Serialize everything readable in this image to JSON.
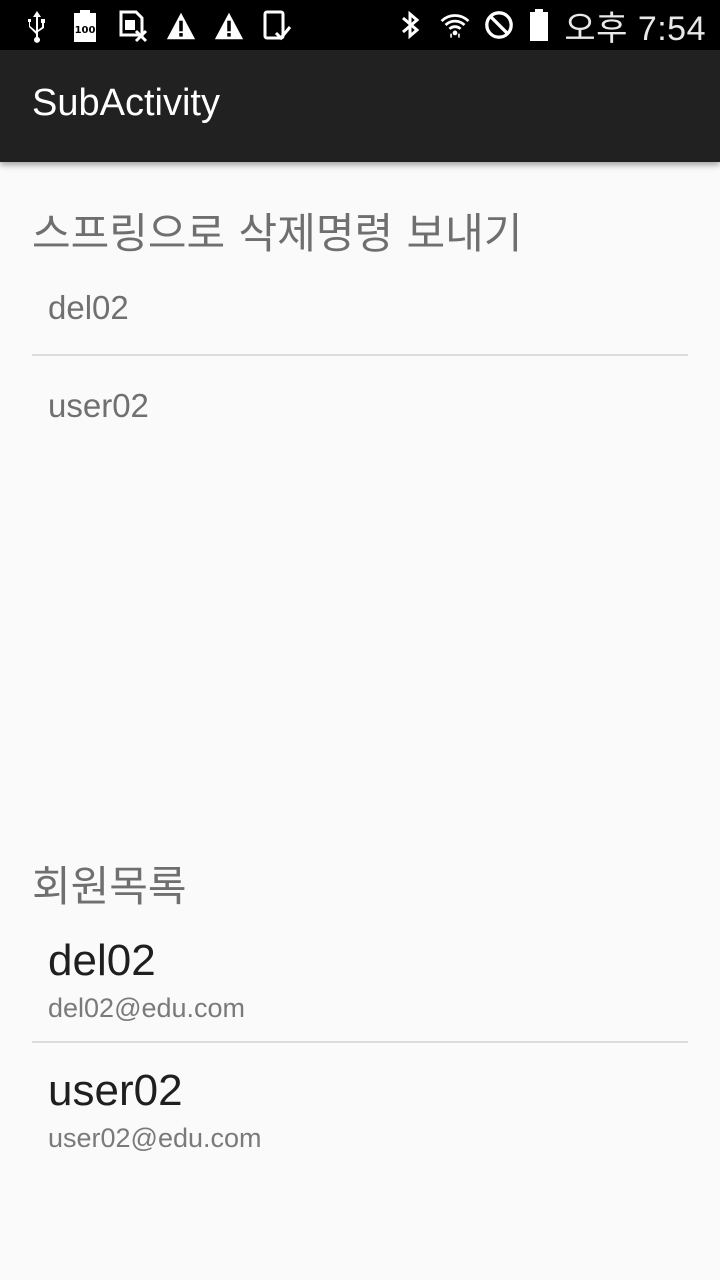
{
  "status_bar": {
    "left_icons": [
      "usb-icon",
      "battery-100-icon",
      "sim-blocked-icon",
      "warning-icon",
      "warning-icon",
      "tablet-check-icon"
    ],
    "right_icons": [
      "bluetooth-icon",
      "wifi-icon",
      "block-icon",
      "battery-icon"
    ],
    "time": "오후 7:54"
  },
  "app_bar": {
    "title": "SubActivity"
  },
  "delete_section": {
    "title": "스프링으로 삭제명령 보내기",
    "items": [
      "del02",
      "user02"
    ]
  },
  "members_section": {
    "title": "회원목록",
    "members": [
      {
        "name": "del02",
        "email": "del02@edu.com"
      },
      {
        "name": "user02",
        "email": "user02@edu.com"
      }
    ]
  },
  "colors": {
    "status_bar": "#000000",
    "app_bar": "#212121",
    "background": "#fafafa",
    "divider": "#dcdcdc"
  }
}
